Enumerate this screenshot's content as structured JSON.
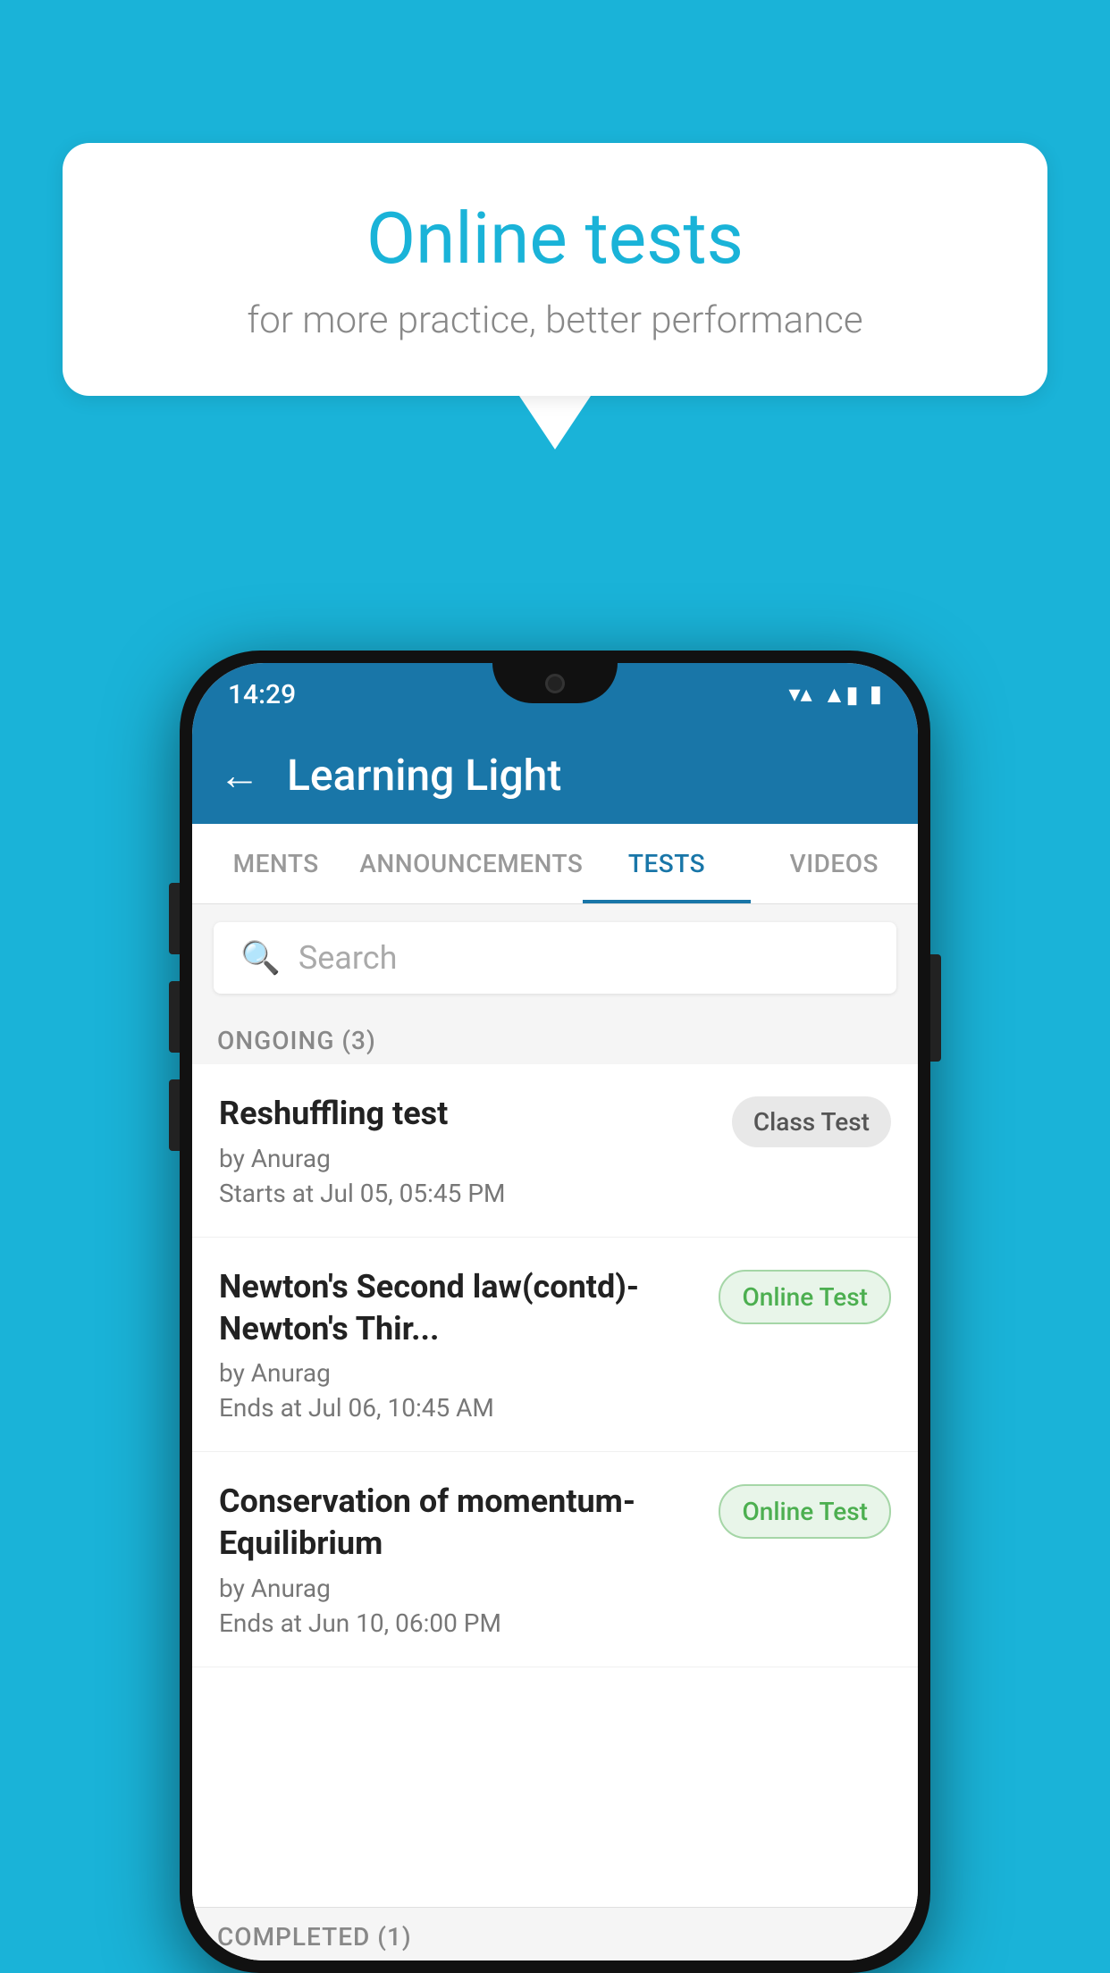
{
  "background_color": "#1ab3d8",
  "speech_bubble": {
    "title": "Online tests",
    "subtitle": "for more practice, better performance"
  },
  "phone": {
    "status_bar": {
      "time": "14:29",
      "wifi": "▼",
      "signal": "▲",
      "battery": "▮"
    },
    "app_bar": {
      "title": "Learning Light",
      "back_label": "←"
    },
    "tabs": [
      {
        "label": "MENTS",
        "active": false
      },
      {
        "label": "ANNOUNCEMENTS",
        "active": false
      },
      {
        "label": "TESTS",
        "active": true
      },
      {
        "label": "VIDEOS",
        "active": false
      }
    ],
    "search": {
      "placeholder": "Search"
    },
    "ongoing_section": {
      "label": "ONGOING (3)",
      "items": [
        {
          "title": "Reshuffling test",
          "author": "by Anurag",
          "date": "Starts at  Jul 05, 05:45 PM",
          "badge": "Class Test",
          "badge_type": "class"
        },
        {
          "title": "Newton's Second law(contd)-Newton's Thir...",
          "author": "by Anurag",
          "date": "Ends at  Jul 06, 10:45 AM",
          "badge": "Online Test",
          "badge_type": "online"
        },
        {
          "title": "Conservation of momentum-Equilibrium",
          "author": "by Anurag",
          "date": "Ends at  Jun 10, 06:00 PM",
          "badge": "Online Test",
          "badge_type": "online"
        }
      ]
    },
    "completed_section": {
      "label": "COMPLETED (1)"
    }
  }
}
